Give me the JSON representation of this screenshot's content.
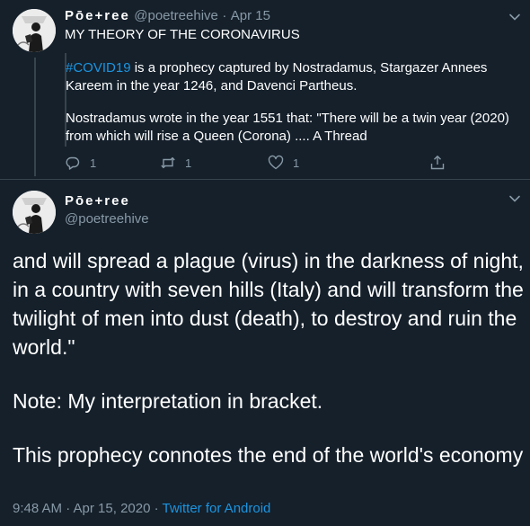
{
  "tweet1": {
    "name": "Pōe+ree",
    "handle": "@poetreehive",
    "dot": "·",
    "date": "Apr 15",
    "title": "MY THEORY OF THE CORONAVIRUS",
    "hashtag": "#COVID19",
    "para1_rest": " is a prophecy captured by Nostradamus, Stargazer Annees Kareem in the year 1246, and Davenci Partheus.",
    "para2": "Nostradamus wrote in the year 1551 that: \"There will be a twin year (2020) from which will rise a Queen (Corona) .... A Thread",
    "reply_count": "1",
    "retweet_count": "1",
    "like_count": "1"
  },
  "tweet2": {
    "name": "Pōe+ree",
    "handle": "@poetreehive",
    "para1": "and will spread a plague (virus) in the darkness of night, in a country with seven hills (Italy) and will transform the twilight of men into dust (death), to destroy and ruin the world.\"",
    "para2": "Note: My interpretation in bracket.",
    "para3": "This prophecy connotes the end of the world's economy",
    "timestamp": "9:48 AM · Apr 15, 2020",
    "sep": " · ",
    "source": "Twitter for Android"
  },
  "icons": {
    "avatar": "avatar-image",
    "more": "chevron-down-icon",
    "reply": "reply-icon",
    "retweet": "retweet-icon",
    "like": "heart-icon",
    "share": "share-icon"
  },
  "colors": {
    "background": "#15202b",
    "accent": "#1b95e0",
    "muted": "#8899a6",
    "divider": "#38444d"
  }
}
